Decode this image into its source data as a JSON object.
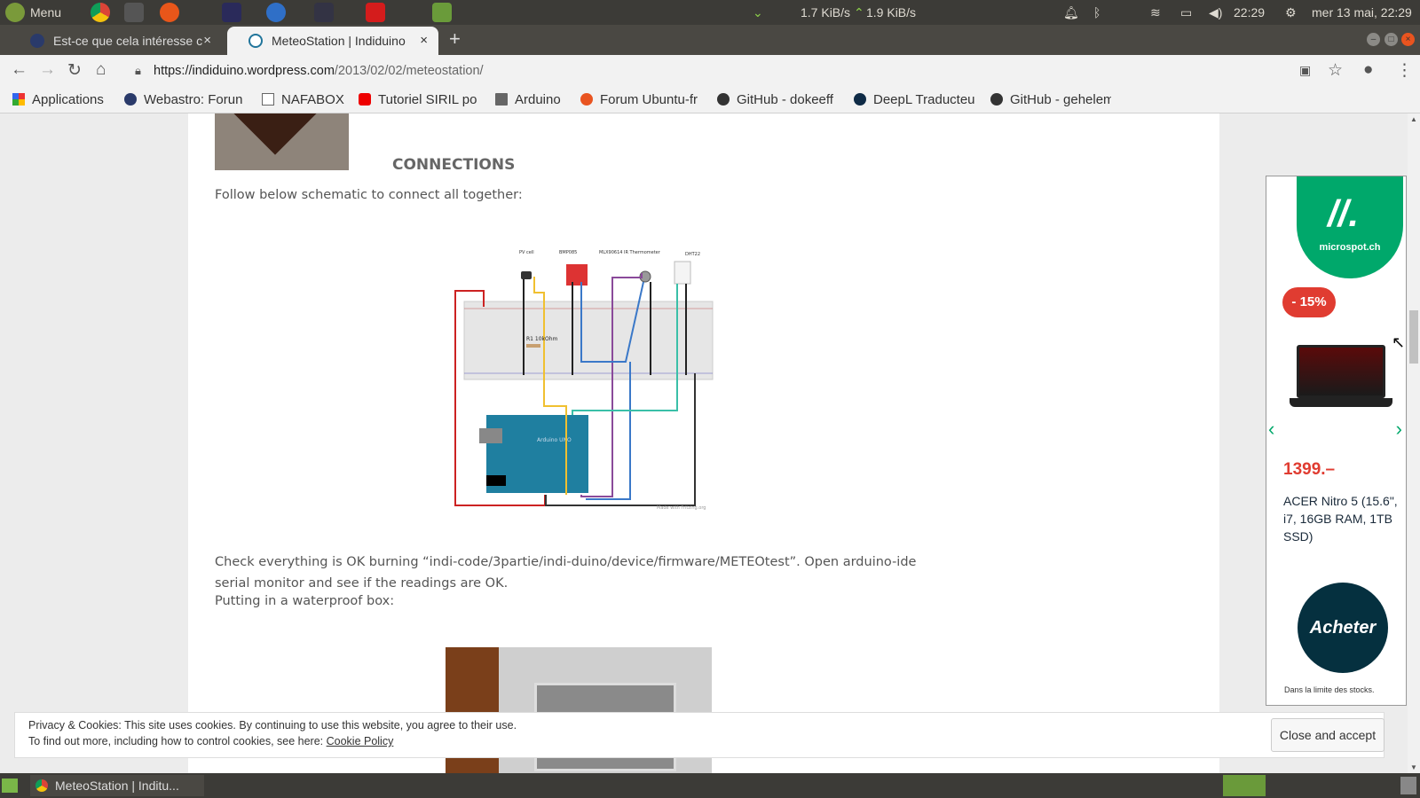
{
  "top_panel": {
    "menu_label": "Menu",
    "net_down": "1.7 KiB/s",
    "net_up": "1.9 KiB/s",
    "time": "22:29",
    "date": "mer 13 mai, 22:29"
  },
  "tabs": [
    {
      "title": "Est-ce que cela intéresse c"
    },
    {
      "title": "MeteoStation | Indiduino"
    }
  ],
  "address": {
    "url_host": "https://indiduino.wordpress.com",
    "url_path": "/2013/02/02/meteostation/"
  },
  "bookmarks": [
    "Applications",
    "Webastro: Forun",
    "NAFABOX",
    "Tutoriel SIRIL po",
    "Arduino",
    "Forum Ubuntu-fr",
    "GitHub - dokeeff",
    "DeepL Traducteu",
    "GitHub - gehelem"
  ],
  "article": {
    "heading": "CONNECTIONS",
    "intro": "Follow below schematic to connect all together:",
    "schematic_labels": {
      "pv": "PV cell",
      "bmp": "BMP085",
      "mlx": "MLX90614 IR Thermometer",
      "dht": "DHT22",
      "resistor": "R1 10kOhm",
      "board": "Arduino UNO",
      "credit": "Made with Fritzing.org"
    },
    "para1": "Check everything is OK burning  “indi-code/3partie/indi-duino/device/firmware/METEOtest”. Open arduino-ide serial monitor and see if the readings are OK.",
    "para2": "Putting in a waterproof box:"
  },
  "ad": {
    "brand": "microspot.ch",
    "discount": "- 15%",
    "price": "1399.–",
    "product": "ACER Nitro 5 (15.6\", i7, 16GB RAM, 1TB SSD)",
    "cta": "Acheter",
    "note": "Dans la limite des stocks."
  },
  "cookie": {
    "line1": "Privacy & Cookies: This site uses cookies. By continuing to use this website, you agree to their use.",
    "line2": "To find out more, including how to control cookies, see here: ",
    "link": "Cookie Policy",
    "button": "Close and accept"
  },
  "taskbar": {
    "window": "MeteoStation | Inditu..."
  }
}
